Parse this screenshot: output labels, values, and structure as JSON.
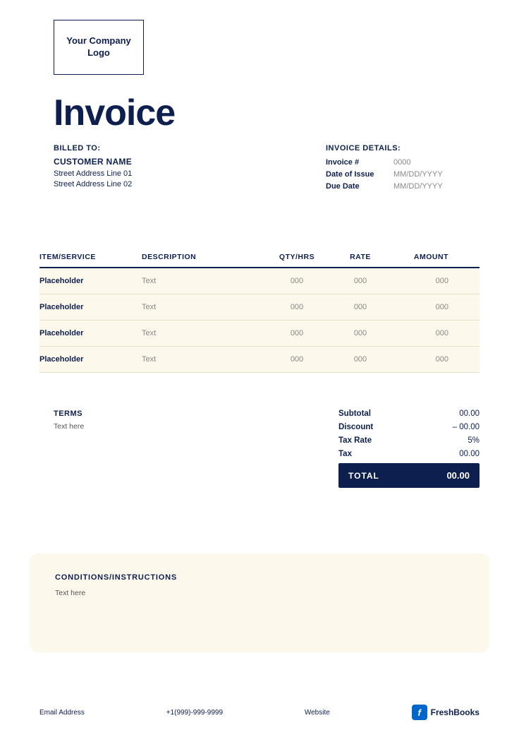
{
  "logo": {
    "text": "Your Company Logo"
  },
  "invoice": {
    "title": "Invoice",
    "billed_to_label": "BILLED TO:",
    "customer_name": "CUSTOMER NAME",
    "street_line1": "Street Address Line 01",
    "street_line2": "Street Address Line 02"
  },
  "details": {
    "header": "INVOICE DETAILS:",
    "invoice_num_label": "Invoice #",
    "invoice_num_value": "0000",
    "date_of_issue_label": "Date of Issue",
    "date_of_issue_value": "MM/DD/YYYY",
    "due_date_label": "Due Date",
    "due_date_value": "MM/DD/YYYY"
  },
  "table": {
    "headers": [
      "ITEM/SERVICE",
      "DESCRIPTION",
      "QTY/HRS",
      "RATE",
      "AMOUNT"
    ],
    "rows": [
      {
        "item": "Placeholder",
        "desc": "Text",
        "qty": "000",
        "rate": "000",
        "amount": "000"
      },
      {
        "item": "Placeholder",
        "desc": "Text",
        "qty": "000",
        "rate": "000",
        "amount": "000"
      },
      {
        "item": "Placeholder",
        "desc": "Text",
        "qty": "000",
        "rate": "000",
        "amount": "000"
      },
      {
        "item": "Placeholder",
        "desc": "Text",
        "qty": "000",
        "rate": "000",
        "amount": "000"
      }
    ]
  },
  "totals": {
    "subtotal_label": "Subtotal",
    "subtotal_value": "00.00",
    "discount_label": "Discount",
    "discount_value": "– 00.00",
    "tax_rate_label": "Tax Rate",
    "tax_rate_value": "5%",
    "tax_label": "Tax",
    "tax_value": "00.00",
    "total_label": "TOTAL",
    "total_value": "00.00"
  },
  "terms": {
    "label": "TERMS",
    "text": "Text here"
  },
  "conditions": {
    "label": "CONDITIONS/INSTRUCTIONS",
    "text": "Text here"
  },
  "footer": {
    "email": "Email Address",
    "phone": "+1(999)-999-9999",
    "website": "Website",
    "brand": "FreshBooks",
    "brand_icon": "f"
  }
}
